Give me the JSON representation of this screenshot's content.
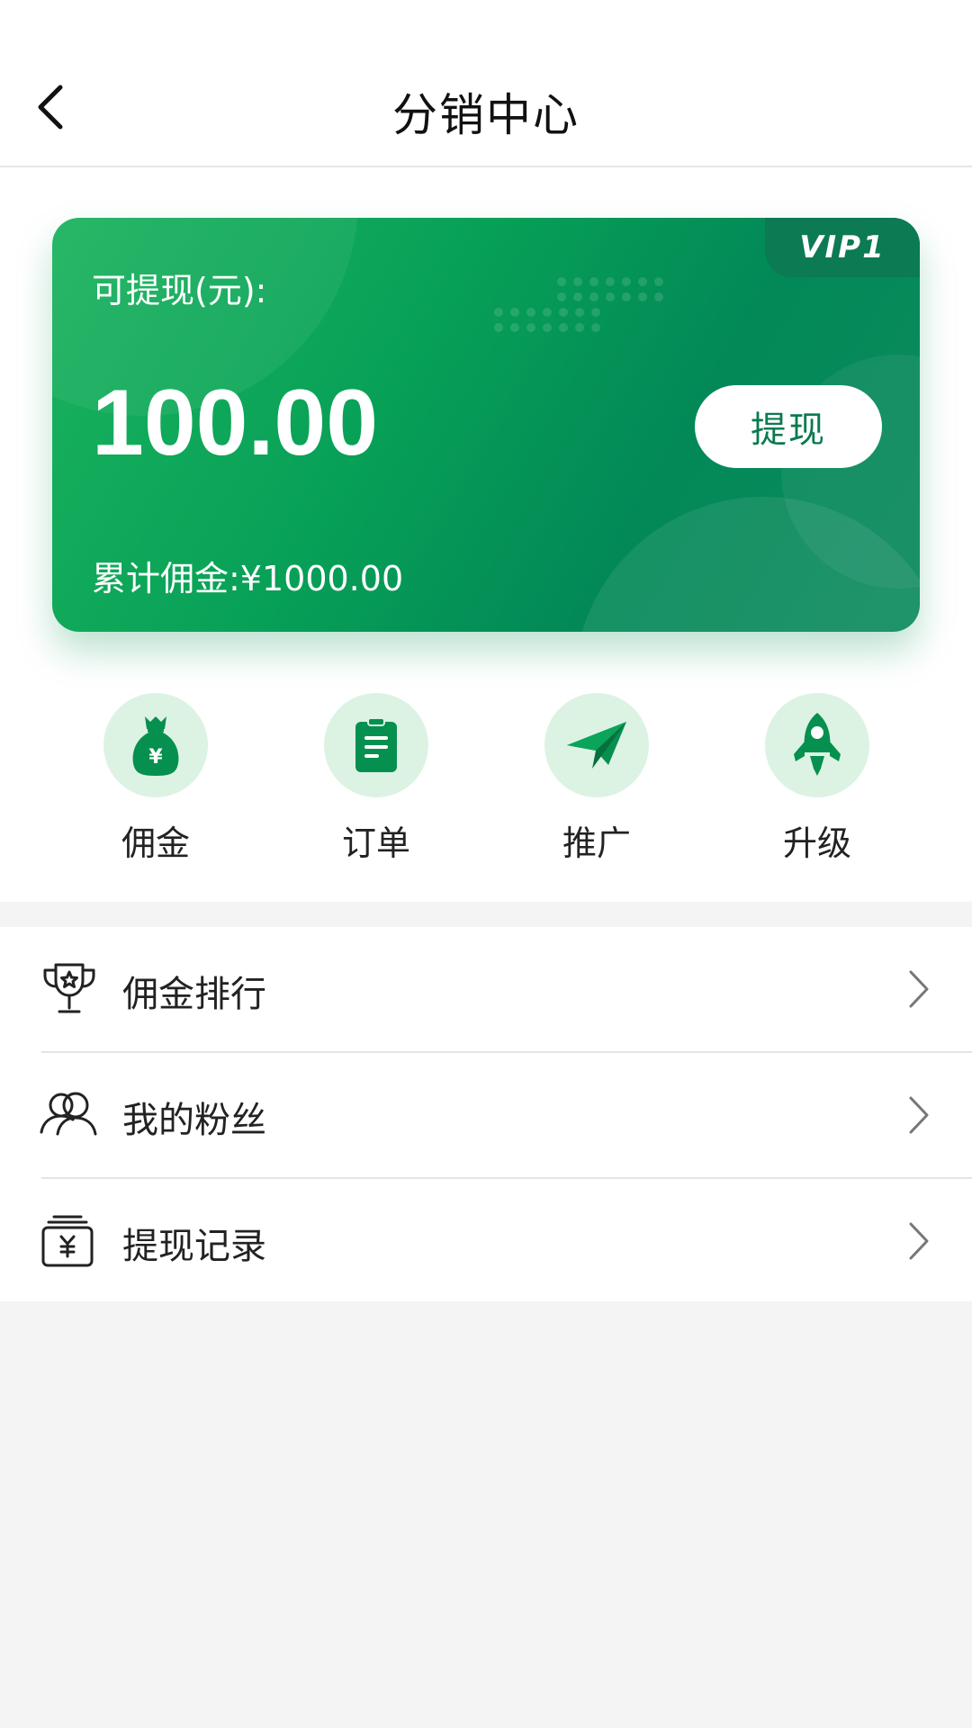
{
  "header": {
    "title": "分销中心",
    "back_icon": "chevron-left-icon"
  },
  "card": {
    "withdrawable_label": "可提现(元):",
    "balance": "100.00",
    "withdraw_button_label": "提现",
    "total_commission": "累计佣金:¥1000.00",
    "vip_badge": "VIP1",
    "colors": {
      "gradient_start": "#1bb35e",
      "gradient_end": "#028957",
      "badge_bg": "#0c7a53",
      "button_text": "#0a7a4e"
    }
  },
  "quick_actions": [
    {
      "label": "佣金",
      "icon": "money-bag-icon"
    },
    {
      "label": "订单",
      "icon": "clipboard-icon"
    },
    {
      "label": "推广",
      "icon": "paper-plane-icon"
    },
    {
      "label": "升级",
      "icon": "rocket-icon"
    }
  ],
  "menu": [
    {
      "label": "佣金排行",
      "icon": "trophy-icon"
    },
    {
      "label": "我的粉丝",
      "icon": "users-icon"
    },
    {
      "label": "提现记录",
      "icon": "wallet-yen-icon"
    }
  ]
}
